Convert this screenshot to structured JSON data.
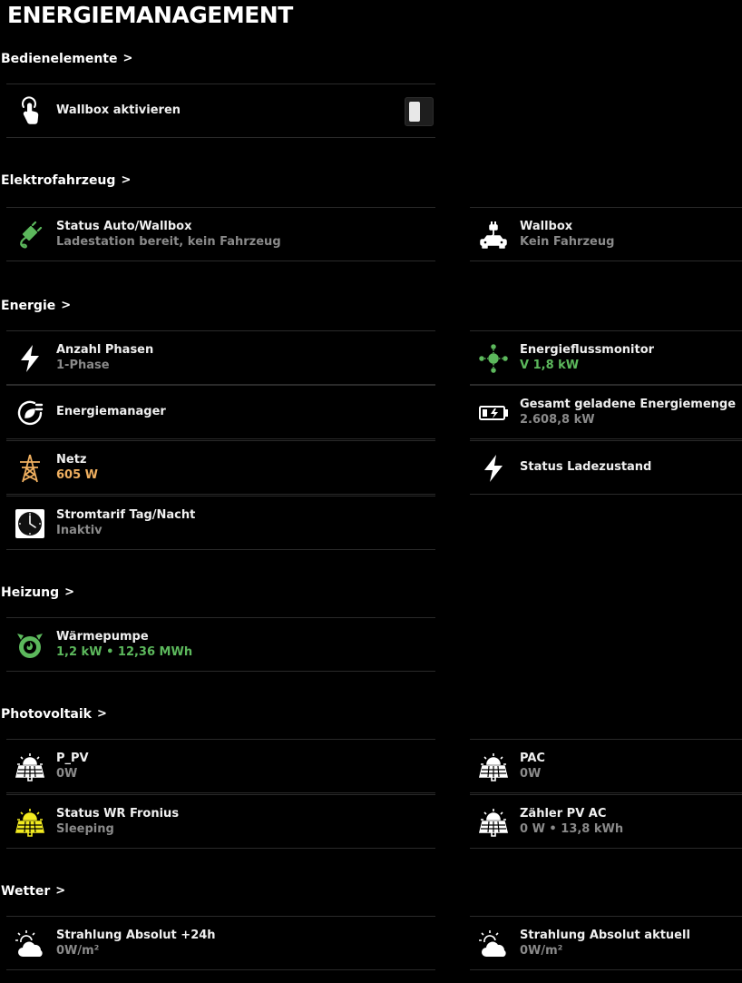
{
  "page_title": "ENERGIEMANAGEMENT",
  "colors": {
    "background": "#000000",
    "green": "#5cb85c",
    "orange": "#f0b060",
    "yellow": "#f2ea20",
    "grey": "#8a8a8a"
  },
  "sections": {
    "bedien": {
      "title": "Bedienelemente",
      "chevron": ">"
    },
    "elektro": {
      "title": "Elektrofahrzeug",
      "chevron": ">"
    },
    "energie": {
      "title": "Energie",
      "chevron": ">"
    },
    "heizung": {
      "title": "Heizung",
      "chevron": ">"
    },
    "pv": {
      "title": "Photovoltaik",
      "chevron": ">"
    },
    "wetter": {
      "title": "Wetter",
      "chevron": ">"
    }
  },
  "tiles": {
    "wallbox_aktivieren": {
      "label": "Wallbox aktivieren",
      "icon": "touch-hand-icon",
      "toggle_state": "off"
    },
    "status_auto": {
      "label": "Status Auto/Wallbox",
      "value": "Ladestation bereit, kein Fahrzeug",
      "icon": "ev-plug-icon"
    },
    "wallbox": {
      "label": "Wallbox",
      "value": "Kein Fahrzeug",
      "icon": "car-charging-icon"
    },
    "anzahl_phasen": {
      "label": "Anzahl Phasen",
      "value": "1-Phase",
      "icon": "lightning-icon"
    },
    "energieflussmonitor": {
      "label": "Energieflussmonitor",
      "value": "V 1,8 kW",
      "icon": "energy-flow-icon"
    },
    "energiemanager": {
      "label": "Energiemanager",
      "icon": "eco-plug-icon"
    },
    "gesamt_energie": {
      "label": "Gesamt geladene Energiemenge",
      "value": "2.608,8 kW",
      "icon": "battery-charging-icon"
    },
    "netz": {
      "label": "Netz",
      "value": "605 W",
      "icon": "power-pylon-icon"
    },
    "status_ladezustand": {
      "label": "Status Ladezustand",
      "icon": "lightning-icon"
    },
    "stromtarif": {
      "label": "Stromtarif Tag/Nacht",
      "value": "Inaktiv",
      "icon": "clock-icon"
    },
    "waermepumpe": {
      "label": "Wärmepumpe",
      "value": "1,2 kW • 12,36 MWh",
      "icon": "heat-pump-icon"
    },
    "p_pv": {
      "label": "P_PV",
      "value": "0W",
      "icon": "solar-panel-icon"
    },
    "pac": {
      "label": "PAC",
      "value": "0W",
      "icon": "solar-panel-icon"
    },
    "status_wr": {
      "label": "Status WR Fronius",
      "value": "Sleeping",
      "icon": "solar-panel-icon"
    },
    "zaehler_pv": {
      "label": "Zähler PV AC",
      "value": "0 W • 13,8 kWh",
      "icon": "solar-panel-icon"
    },
    "strahlung_24h": {
      "label": "Strahlung Absolut +24h",
      "value": "0W/m²",
      "icon": "sun-cloud-icon"
    },
    "strahlung_aktuell": {
      "label": "Strahlung Absolut aktuell",
      "value": "0W/m²",
      "icon": "sun-cloud-icon"
    }
  }
}
